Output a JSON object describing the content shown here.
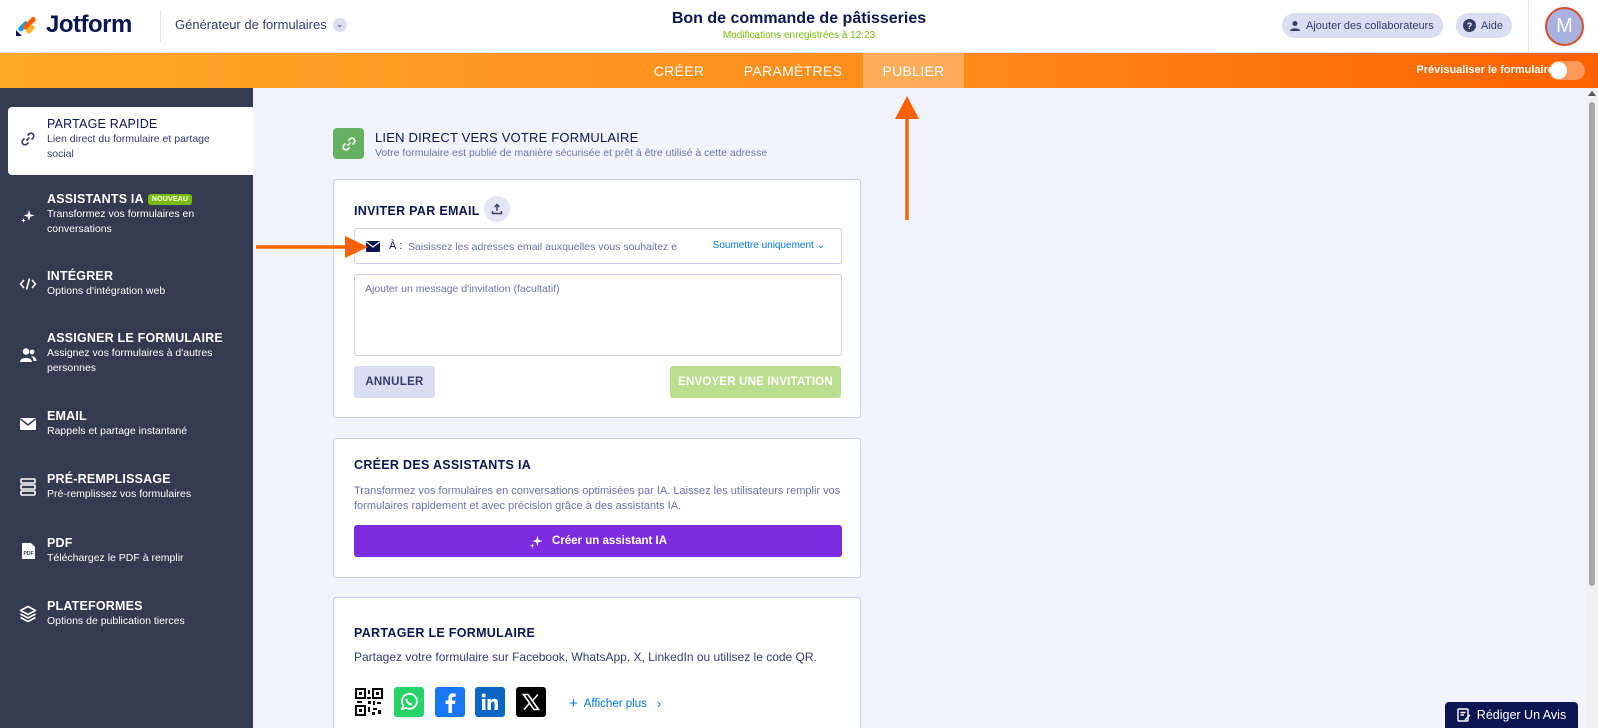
{
  "header": {
    "brand": "Jotform",
    "builder_label": "Générateur de formulaires",
    "form_title": "Bon de commande de pâtisseries",
    "saved_status": "Modifications enregistrées à 12:23",
    "collaborators_label": "Ajouter des collaborateurs",
    "help_label": "Aide",
    "avatar_initial": "M"
  },
  "nav": {
    "tabs": [
      {
        "label": "CRÉER",
        "active": false
      },
      {
        "label": "PARAMÈTRES",
        "active": false
      },
      {
        "label": "PUBLIER",
        "active": true
      }
    ],
    "preview_label": "Prévisualiser le formulaire",
    "preview_enabled": false
  },
  "sidebar": {
    "items": [
      {
        "title": "PARTAGE RAPIDE",
        "desc": "Lien direct du formulaire et partage social",
        "icon": "link-icon",
        "active": true
      },
      {
        "title": "ASSISTANTS IA",
        "badge": "NOUVEAU",
        "desc": "Transformez vos formulaires en conversations",
        "icon": "sparkle-icon"
      },
      {
        "title": "INTÉGRER",
        "desc": "Options d'intégration web",
        "icon": "code-icon"
      },
      {
        "title": "ASSIGNER LE FORMULAIRE",
        "desc": "Assignez vos formulaires à d'autres personnes",
        "icon": "users-icon"
      },
      {
        "title": "EMAIL",
        "desc": "Rappels et partage instantané",
        "icon": "envelope-icon"
      },
      {
        "title": "PRÉ-REMPLISSAGE",
        "desc": "Pré-remplissez vos formulaires",
        "icon": "prefill-icon"
      },
      {
        "title": "PDF",
        "desc": "Téléchargez le PDF à remplir",
        "icon": "pdf-icon"
      },
      {
        "title": "PLATEFORMES",
        "desc": "Options de publication tierces",
        "icon": "layers-icon"
      }
    ]
  },
  "direct_link": {
    "title": "LIEN DIRECT VERS VOTRE FORMULAIRE",
    "subtitle": "Votre formulaire est publié de manière sécurisée et prêt à être utilisé à cette adresse"
  },
  "invite": {
    "title": "INVITER PAR EMAIL",
    "to_label": "À :",
    "email_placeholder": "Saisissez les adresses email auxquelles vous souhaitez e",
    "mode_label": "Soumettre uniquement",
    "message_placeholder": "Ajouter un message d'invitation (facultatif)",
    "cancel_label": "ANNULER",
    "send_label": "ENVOYER UNE INVITATION"
  },
  "ai_card": {
    "title": "CRÉER DES ASSISTANTS IA",
    "desc": "Transformez vos formulaires en conversations optimisées par IA. Laissez les utilisateurs remplir vos formulaires rapidement et avec précision grâce à des assistants IA.",
    "button_label": "Créer un assistant IA"
  },
  "share_card": {
    "title": "PARTAGER LE FORMULAIRE",
    "desc": "Partagez votre formulaire sur Facebook, WhatsApp, X, LinkedIn ou utilisez le code QR.",
    "networks": [
      "qr-code-icon",
      "whatsapp-icon",
      "facebook-icon",
      "linkedin-icon",
      "x-icon"
    ],
    "show_more_label": "Afficher plus"
  },
  "review_label": "Rédiger Un Avis",
  "colors": {
    "accent_orange": "#ff6100",
    "sidebar_bg": "#343a4f",
    "purple": "#7d2be0",
    "green": "#64b261"
  }
}
